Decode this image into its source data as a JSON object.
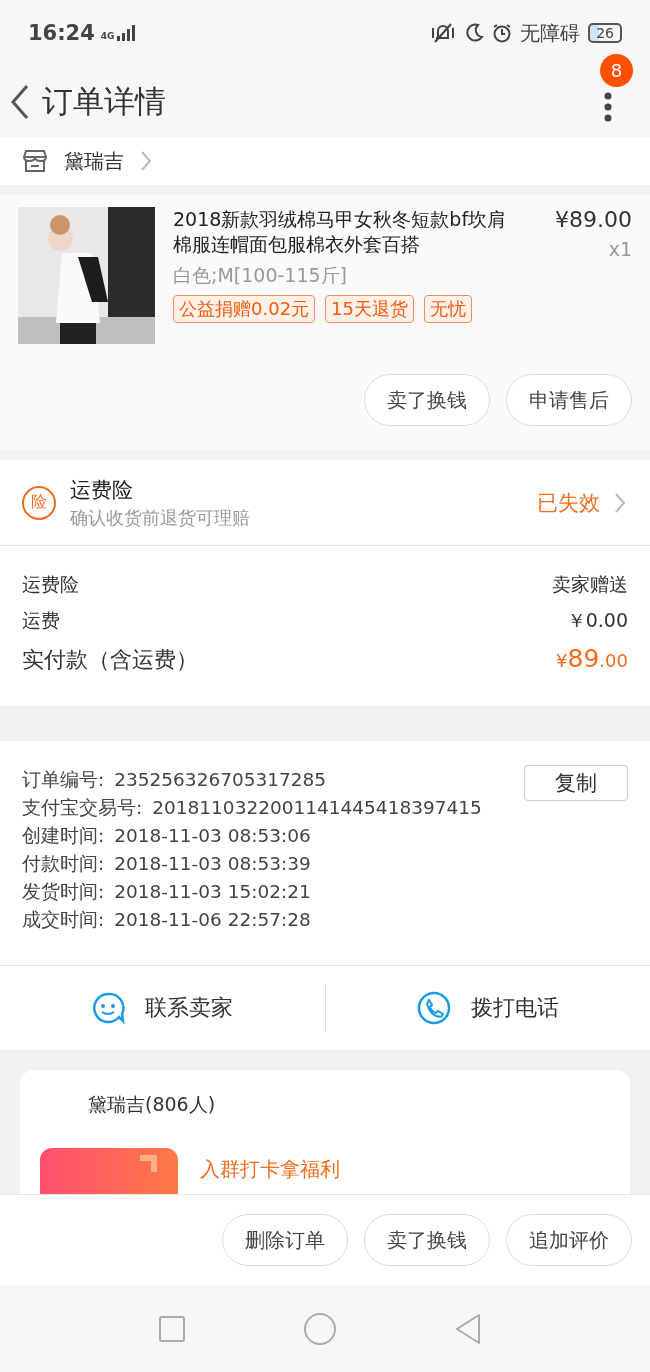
{
  "status_bar": {
    "time": "16:24",
    "network": "4G",
    "accessibility": "无障碍",
    "battery": "26"
  },
  "header": {
    "title": "订单详情",
    "badge": "8"
  },
  "shop": {
    "name": "黛瑞吉"
  },
  "product": {
    "kind": "picture",
    "title": "2018新款羽绒棉马甲女秋冬短款bf坎肩棉服连帽面包服棉衣外套百搭",
    "price": "¥89.00",
    "quantity": "x1",
    "variant": "白色;M[100-115斤]",
    "tags": [
      "公益捐赠0.02元",
      "15天退货",
      "无忧"
    ],
    "buttons": [
      "卖了换钱",
      "申请售后"
    ]
  },
  "insurance": {
    "icon": "险",
    "title": "运费险",
    "subtitle": "确认收货前退货可理赔",
    "status": "已失效"
  },
  "fees": [
    {
      "kind": "line",
      "label": "运费险",
      "value": "卖家赠送"
    },
    {
      "kind": "line",
      "label": "运费",
      "value": "￥0.00"
    },
    {
      "kind": "total",
      "label": "实付款（含运费）",
      "currency": "¥",
      "amount": "89",
      "cents": ".00"
    }
  ],
  "order_info": {
    "copy_button": "复制",
    "rows": [
      {
        "label": "订单编号:",
        "value": "235256326705317285"
      },
      {
        "label": "支付宝交易号:",
        "value": "2018110322001141445418397415"
      },
      {
        "label": "创建时间:",
        "value": "2018-11-03 08:53:06"
      },
      {
        "label": "付款时间:",
        "value": "2018-11-03 08:53:39"
      },
      {
        "label": "发货时间:",
        "value": "2018-11-03 15:02:21"
      },
      {
        "label": "成交时间:",
        "value": "2018-11-06 22:57:28"
      }
    ]
  },
  "contact": [
    {
      "kind": "chat",
      "label": "联系卖家"
    },
    {
      "kind": "phone",
      "label": "拨打电话"
    }
  ],
  "group": {
    "name": "黛瑞吉(806人)",
    "promo": "入群打卡拿福利"
  },
  "actions": [
    "删除订单",
    "卖了换钱",
    "追加评价"
  ]
}
